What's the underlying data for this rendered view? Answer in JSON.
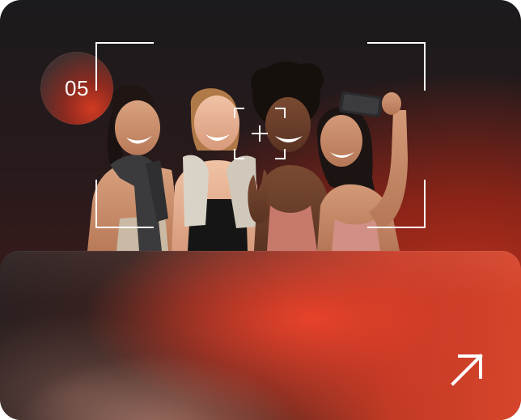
{
  "card": {
    "step_number": "05",
    "photo_description_icon": "group-selfie-photo",
    "frame_icon": "camera-frame-corners",
    "focus_icon": "focus-reticle-icon",
    "action_icon": "arrow-up-right-icon"
  },
  "colors": {
    "accent": "#e7422a",
    "background_dark": "#1b1a1c",
    "foreground": "#ffffff"
  }
}
